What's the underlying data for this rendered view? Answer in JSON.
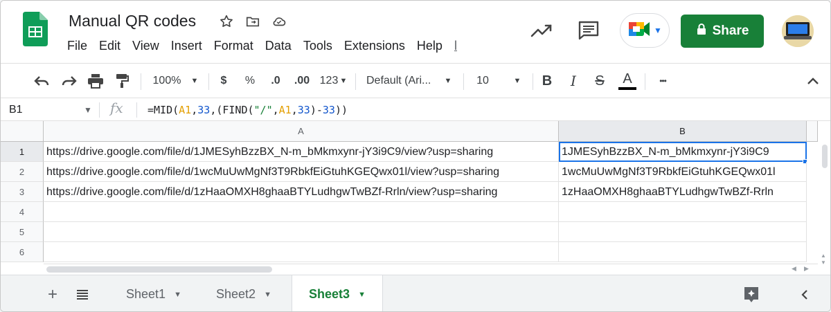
{
  "header": {
    "doc_title": "Manual QR codes",
    "menu": [
      "File",
      "Edit",
      "View",
      "Insert",
      "Format",
      "Data",
      "Tools",
      "Extensions",
      "Help",
      "l"
    ],
    "share_label": "Share"
  },
  "toolbar": {
    "zoom": "100%",
    "currency": "$",
    "percent": "%",
    "dec_decrease": ".0",
    "dec_increase": ".00",
    "more_formats": "123",
    "font": "Default (Ari...",
    "font_size": "10",
    "bold": "B",
    "italic": "I",
    "strike": "S",
    "text_color": "A",
    "more": "•••"
  },
  "formula_bar": {
    "name_box": "B1",
    "fx": "fx",
    "formula_parts": [
      "=MID(",
      "A1",
      ",",
      "33",
      ",(FIND(",
      "\"/\"",
      ",",
      "A1",
      ",",
      "33",
      ")-",
      "33",
      "))"
    ]
  },
  "grid": {
    "columns": [
      "A",
      "B"
    ],
    "row_numbers": [
      "1",
      "2",
      "3",
      "4",
      "5",
      "6"
    ],
    "rows": [
      [
        "https://drive.google.com/file/d/1JMESyhBzzBX_N-m_bMkmxynr-jY3i9C9/view?usp=sharing",
        "1JMESyhBzzBX_N-m_bMkmxynr-jY3i9C9"
      ],
      [
        "https://drive.google.com/file/d/1wcMuUwMgNf3T9RbkfEiGtuhKGEQwx01l/view?usp=sharing",
        "1wcMuUwMgNf3T9RbkfEiGtuhKGEQwx01l"
      ],
      [
        "https://drive.google.com/file/d/1zHaaOMXH8ghaaBTYLudhgwTwBZf-Rrln/view?usp=sharing",
        "1zHaaOMXH8ghaaBTYLudhgwTwBZf-Rrln"
      ],
      [
        "",
        ""
      ],
      [
        "",
        ""
      ],
      [
        "",
        ""
      ]
    ]
  },
  "sheets": {
    "tabs": [
      "Sheet1",
      "Sheet2",
      "Sheet3"
    ],
    "active": "Sheet3"
  },
  "colors": {
    "share_green": "#188038",
    "selection_blue": "#1a73e8",
    "formula_ref": "#e39e00",
    "formula_num": "#1155cc"
  }
}
